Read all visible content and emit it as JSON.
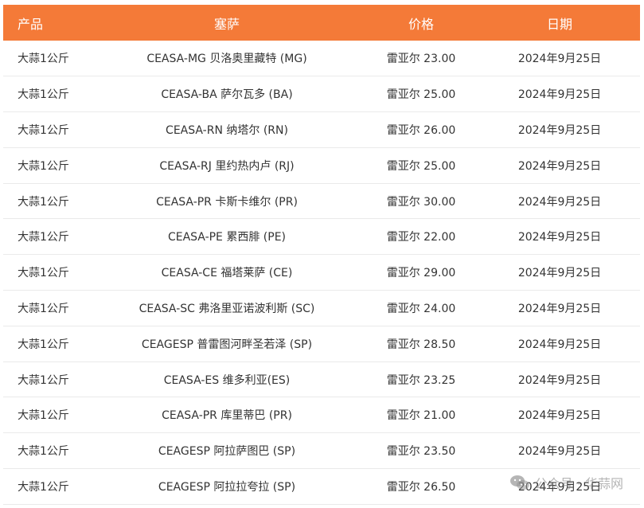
{
  "table": {
    "headers": [
      "产品",
      "塞萨",
      "价格",
      "日期"
    ],
    "rows": [
      [
        "大蒜1公斤",
        "CEASA-MG 贝洛奥里藏特 (MG)",
        "雷亚尔 23.00",
        "2024年9月25日"
      ],
      [
        "大蒜1公斤",
        "CEASA-BA 萨尔瓦多 (BA)",
        "雷亚尔 25.00",
        "2024年9月25日"
      ],
      [
        "大蒜1公斤",
        "CEASA-RN 纳塔尔 (RN)",
        "雷亚尔 26.00",
        "2024年9月25日"
      ],
      [
        "大蒜1公斤",
        "CEASA-RJ 里约热内卢 (RJ)",
        "雷亚尔 25.00",
        "2024年9月25日"
      ],
      [
        "大蒜1公斤",
        "CEASA-PR 卡斯卡维尔 (PR)",
        "雷亚尔 30.00",
        "2024年9月25日"
      ],
      [
        "大蒜1公斤",
        "CEASA-PE 累西腓 (PE)",
        "雷亚尔 22.00",
        "2024年9月25日"
      ],
      [
        "大蒜1公斤",
        "CEASA-CE 福塔莱萨 (CE)",
        "雷亚尔 29.00",
        "2024年9月25日"
      ],
      [
        "大蒜1公斤",
        "CEASA-SC 弗洛里亚诺波利斯 (SC)",
        "雷亚尔 24.00",
        "2024年9月25日"
      ],
      [
        "大蒜1公斤",
        "CEAGESP 普雷图河畔圣若泽 (SP)",
        "雷亚尔 28.50",
        "2024年9月25日"
      ],
      [
        "大蒜1公斤",
        "CEASA-ES 维多利亚(ES)",
        "雷亚尔 23.25",
        "2024年9月25日"
      ],
      [
        "大蒜1公斤",
        "CEASA-PR 库里蒂巴 (PR)",
        "雷亚尔 21.00",
        "2024年9月25日"
      ],
      [
        "大蒜1公斤",
        "CEAGESP 阿拉萨图巴 (SP)",
        "雷亚尔 23.50",
        "2024年9月25日"
      ],
      [
        "大蒜1公斤",
        "CEAGESP 阿拉拉夸拉 (SP)",
        "雷亚尔 26.50",
        "2024年9月25日"
      ]
    ]
  },
  "watermark": {
    "text": "公众号 · 华蒜网",
    "icon": "wechat-icon"
  },
  "colors": {
    "header_bg": "#f47a38",
    "header_text": "#ffffff",
    "row_border": "#eaeaea",
    "text": "#333333"
  }
}
